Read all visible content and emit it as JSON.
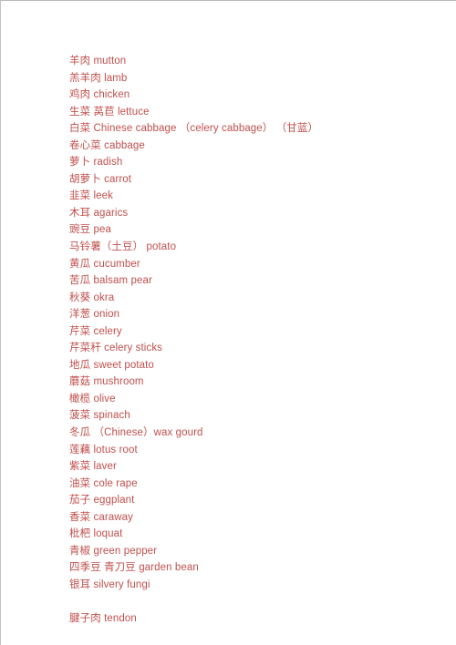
{
  "document": {
    "text_color": "#c0504d",
    "background_color": "#ffffff",
    "border_color": "#b9b9b9",
    "lines": [
      {
        "id": "mutton",
        "text": "羊肉 mutton"
      },
      {
        "id": "lamb",
        "text": "羔羊肉 lamb"
      },
      {
        "id": "chicken",
        "text": "鸡肉 chicken"
      },
      {
        "id": "lettuce",
        "text": "生菜 莴苣 lettuce"
      },
      {
        "id": "chinese-cabbage",
        "text": "白菜 Chinese cabbage （celery cabbage） （甘蓝）"
      },
      {
        "id": "cabbage",
        "text": "卷心菜 cabbage"
      },
      {
        "id": "radish",
        "text": "萝卜 radish"
      },
      {
        "id": "carrot",
        "text": "胡萝卜 carrot"
      },
      {
        "id": "leek",
        "text": "韭菜 leek"
      },
      {
        "id": "agarics",
        "text": "木耳 agarics"
      },
      {
        "id": "pea",
        "text": "豌豆 pea"
      },
      {
        "id": "potato",
        "text": "马铃薯（土豆） potato"
      },
      {
        "id": "cucumber",
        "text": "黄瓜 cucumber"
      },
      {
        "id": "balsam-pear",
        "text": "苦瓜 balsam pear"
      },
      {
        "id": "okra",
        "text": "秋葵 okra"
      },
      {
        "id": "onion",
        "text": "洋葱 onion"
      },
      {
        "id": "celery",
        "text": "芹菜 celery"
      },
      {
        "id": "celery-sticks",
        "text": "芹菜秆 celery sticks"
      },
      {
        "id": "sweet-potato",
        "text": "地瓜 sweet potato"
      },
      {
        "id": "mushroom",
        "text": "蘑菇 mushroom"
      },
      {
        "id": "olive",
        "text": "橄榄 olive"
      },
      {
        "id": "spinach",
        "text": "菠菜 spinach"
      },
      {
        "id": "wax-gourd",
        "text": "冬瓜 （Chinese）wax gourd"
      },
      {
        "id": "lotus-root",
        "text": "莲藕 lotus root"
      },
      {
        "id": "laver",
        "text": "紫菜 laver"
      },
      {
        "id": "cole-rape",
        "text": "油菜 cole rape"
      },
      {
        "id": "eggplant",
        "text": "茄子 eggplant"
      },
      {
        "id": "caraway",
        "text": "香菜 caraway"
      },
      {
        "id": "loquat",
        "text": "枇杷 loquat"
      },
      {
        "id": "green-pepper",
        "text": "青椒 green pepper"
      },
      {
        "id": "garden-bean",
        "text": "四季豆 青刀豆 garden bean"
      },
      {
        "id": "silvery-fungi",
        "text": "银耳 silvery fungi"
      },
      {
        "id": "spacer",
        "text": " "
      },
      {
        "id": "tendon",
        "text": "腱子肉 tendon"
      }
    ]
  }
}
